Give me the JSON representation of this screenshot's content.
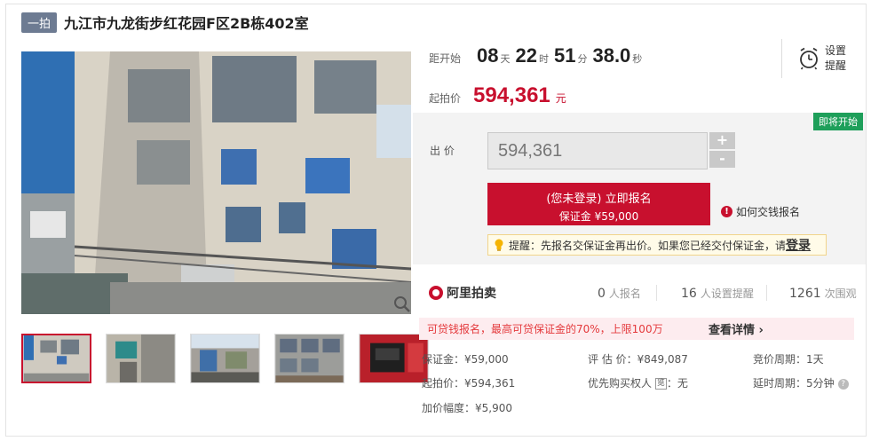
{
  "header": {
    "badge": "一拍",
    "title": "九江市九龙街步红花园F区2B栋402室"
  },
  "countdown": {
    "label": "距开始",
    "days": "08",
    "days_unit": "天",
    "hours": "22",
    "hours_unit": "时",
    "minutes": "51",
    "minutes_unit": "分",
    "seconds": "38.0",
    "seconds_unit": "秒"
  },
  "reminder": {
    "label": "设置提醒",
    "icon": "alarm-clock-icon"
  },
  "start_price": {
    "label": "起拍价",
    "value": "594,361",
    "unit": "元"
  },
  "bid": {
    "soon_tag": "即将开始",
    "label": "出 价",
    "input_value": "594,361",
    "plus": "+",
    "minus": "-",
    "signup_main": "(您未登录) 立即报名",
    "signup_sub": "保证金 ¥59,000",
    "howto": "如何交钱报名",
    "tip_text": "提醒：先报名交保证金再出价。如果您已经交付保证金，请",
    "tip_login": "登录"
  },
  "stats": {
    "brand": "阿里拍卖",
    "signups_count": "0",
    "signups_label": "人报名",
    "reminders_count": "16",
    "reminders_label": "人设置提醒",
    "views_count": "1261",
    "views_label": "次围观"
  },
  "promo": {
    "text": "可贷钱报名，最高可贷保证金的70%，上限100万",
    "link": "查看详情 ›"
  },
  "details": {
    "deposit": "保证金：¥59,000",
    "appraisal": "评 估 价：¥849,087",
    "cycle": "竞价周期：1天",
    "start": "起拍价：¥594,361",
    "priority_label": "优先购买权人",
    "priority_tag": "览",
    "priority_value": "：无",
    "delay": "延时周期：5分钟",
    "increment": "加价幅度：¥5,900"
  },
  "colors": {
    "accent": "#c8102e",
    "soon": "#1e9f5a",
    "badge": "#6d7b92"
  }
}
